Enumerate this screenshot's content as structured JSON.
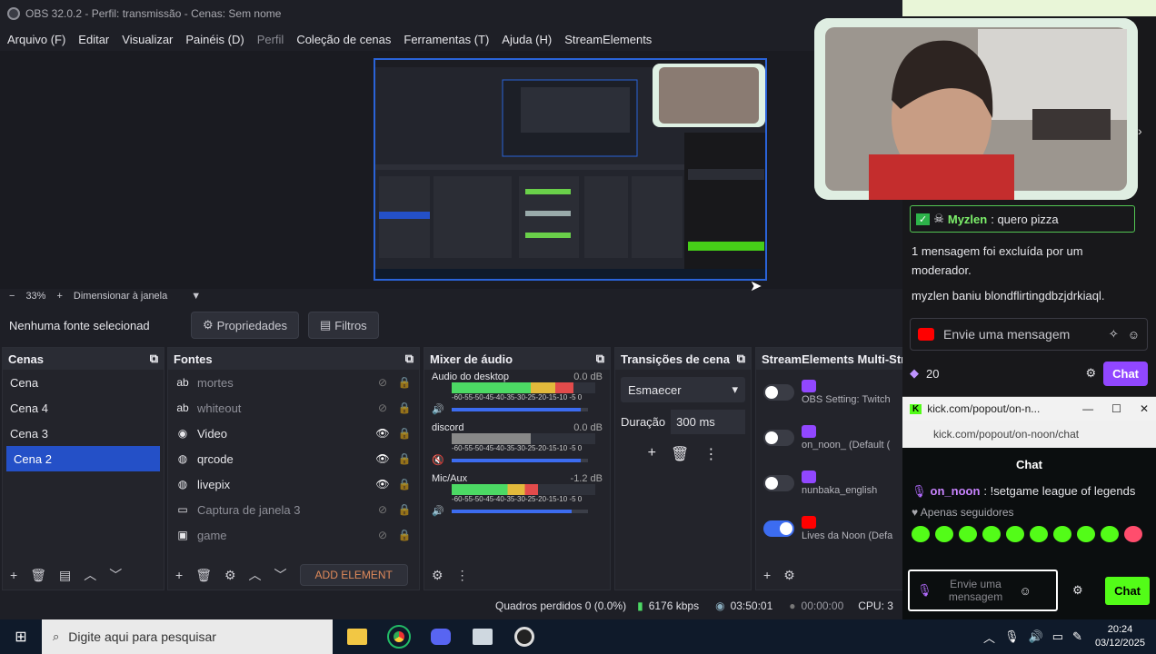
{
  "window": {
    "title": "OBS 32.0.2 - Perfil: transmissão - Cenas: Sem nome"
  },
  "menu": [
    "Arquivo (F)",
    "Editar",
    "Visualizar",
    "Painéis (D)",
    "Perfil",
    "Coleção de cenas",
    "Ferramentas (T)",
    "Ajuda (H)",
    "StreamElements"
  ],
  "zoom": {
    "minus": "−",
    "value": "33%",
    "plus": "+",
    "fit_label": "Dimensionar à janela"
  },
  "source_bar": {
    "no_source": "Nenhuma fonte selecionad",
    "properties": "Propriedades",
    "filters": "Filtros"
  },
  "scenes": {
    "title": "Cenas",
    "items": [
      "Cena",
      "Cena 4",
      "Cena 3",
      "Cena 2"
    ],
    "selected_index": 3
  },
  "sources": {
    "title": "Fontes",
    "items": [
      {
        "name": "mortes",
        "icon": "text-icon",
        "visible": false
      },
      {
        "name": "whiteout",
        "icon": "text-icon",
        "visible": false
      },
      {
        "name": "Video",
        "icon": "media-icon",
        "visible": true
      },
      {
        "name": "qrcode",
        "icon": "browser-icon",
        "visible": true
      },
      {
        "name": "livepix",
        "icon": "browser-icon",
        "visible": true
      },
      {
        "name": "Captura de janela 3",
        "icon": "window-icon",
        "visible": false
      },
      {
        "name": "game",
        "icon": "game-icon",
        "visible": false
      }
    ],
    "add_element": "ADD ELEMENT"
  },
  "mixer": {
    "title": "Mixer de áudio",
    "tracks": [
      {
        "name": "Audio do desktop",
        "db": "0.0 dB",
        "level": 0.85,
        "volume": 0.95,
        "muted": false
      },
      {
        "name": "discord",
        "db": "0.0 dB",
        "level": 0.55,
        "volume": 0.95,
        "muted": true
      },
      {
        "name": "Mic/Aux",
        "db": "-1.2 dB",
        "level": 0.6,
        "volume": 0.88,
        "muted": false
      }
    ],
    "scale": "-60-55-50-45-40-35-30-25-20-15-10 -5 0"
  },
  "transitions": {
    "title": "Transições de cena",
    "selected": "Esmaecer",
    "duration_label": "Duração",
    "duration_value": "300 ms"
  },
  "multistream": {
    "title": "StreamElements Multi-Str",
    "items": [
      {
        "label": "OBS Setting: Twitch",
        "platform": "twitch",
        "on": false
      },
      {
        "label": "on_noon_ (Default (",
        "platform": "twitch",
        "on": false
      },
      {
        "label": "nunbaka_english",
        "platform": "twitch",
        "on": false
      },
      {
        "label": "Lives da Noon (Defa",
        "platform": "youtube",
        "on": true
      }
    ]
  },
  "status": {
    "frames_dropped": "Quadros perdidos 0 (0.0%)",
    "bitrate": "6176 kbps",
    "stream_time": "03:50:01",
    "rec_time": "00:00:00",
    "cpu": "CPU: 3"
  },
  "twitch_chat": {
    "top_user": "Myzlen",
    "top_message": ": quero pizza",
    "mod_notice": "1 mensagem foi excluída por um moderador.",
    "ban_notice": "myzlen baniu blondflirtingdbzjdrkiaql.",
    "input_placeholder": "Envie uma mensagem",
    "points": "20",
    "chat_button": "Chat"
  },
  "kick_popup": {
    "tab_title": "kick.com/popout/on-n...",
    "url": "kick.com/popout/on-noon/chat",
    "header": "Chat",
    "message_user": "on_noon",
    "message_text": ": !setgame league of legends",
    "followers_only": "Apenas seguidores",
    "input_placeholder": "Envie uma mensagem",
    "chat_button": "Chat"
  },
  "taskbar": {
    "search_placeholder": "Digite aqui para pesquisar",
    "time": "20:24",
    "date": "03/12/2025"
  },
  "colors": {
    "accent": "#2450c7",
    "twitch": "#9147ff",
    "kick": "#53fc18",
    "youtube": "#ff0000"
  }
}
